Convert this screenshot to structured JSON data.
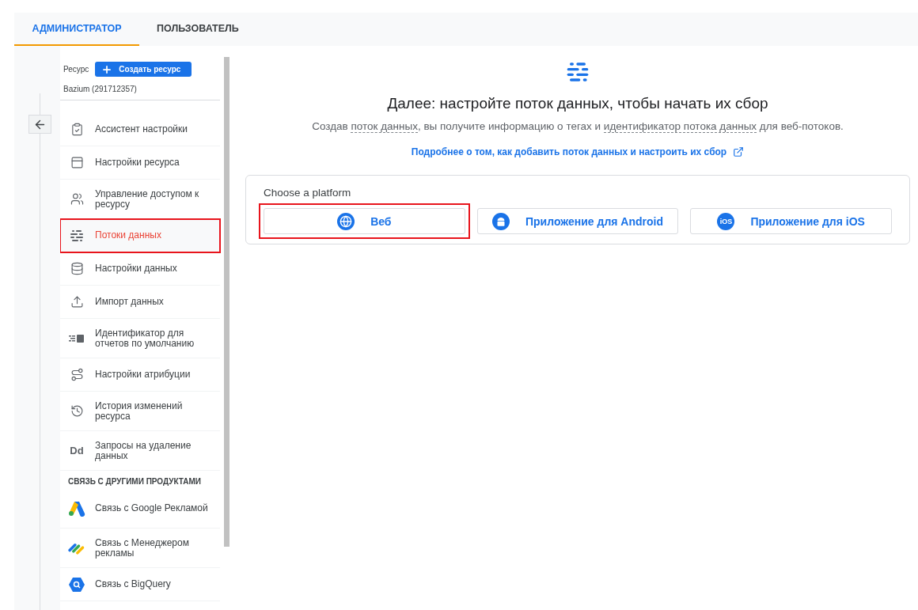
{
  "tabs": [
    {
      "label": "АДМИНИСТРАТОР",
      "selected": true
    },
    {
      "label": "ПОЛЬЗОВАТЕЛЬ",
      "selected": false
    }
  ],
  "resource": {
    "label": "Ресурс",
    "create_button": "Создать ресурс",
    "name": "Bazium (291712357)"
  },
  "sidebar": {
    "sections": [
      {
        "items": [
          {
            "label": "Ассистент настройки",
            "selected": false,
            "highlighted": false
          },
          {
            "label": "Настройки ресурса",
            "selected": false,
            "highlighted": false
          },
          {
            "label": "Управление доступом к ресурсу",
            "selected": false,
            "highlighted": false
          },
          {
            "label": "Потоки данных",
            "selected": true,
            "highlighted": true
          },
          {
            "label": "Настройки данных",
            "selected": false,
            "highlighted": false
          },
          {
            "label": "Импорт данных",
            "selected": false,
            "highlighted": false
          },
          {
            "label": "Идентификатор для отчетов по умолчанию",
            "selected": false,
            "highlighted": false
          },
          {
            "label": "Настройки атрибуции",
            "selected": false,
            "highlighted": false
          },
          {
            "label": "История изменений ресурса",
            "selected": false,
            "highlighted": false
          },
          {
            "label": "Запросы на удаление данных",
            "selected": false,
            "highlighted": false,
            "icon_text": "Dd"
          }
        ]
      },
      {
        "heading": "СВЯЗЬ С ДРУГИМИ ПРОДУКТАМИ",
        "items": [
          {
            "label": "Связь с Google Рекламой",
            "selected": false,
            "highlighted": false
          },
          {
            "label": "Связь с Менеджером рекламы",
            "selected": false,
            "highlighted": false
          },
          {
            "label": "Связь с BigQuery",
            "selected": false,
            "highlighted": false
          }
        ]
      }
    ]
  },
  "main": {
    "title": "Далее: настройте поток данных, чтобы начать их сбор",
    "description": [
      {
        "kind": "plain",
        "text": "Создав "
      },
      {
        "kind": "term",
        "text": "поток данных"
      },
      {
        "kind": "plain",
        "text": ", вы получите информацию о тегах и "
      },
      {
        "kind": "term",
        "text": "идентификатор потока данных"
      },
      {
        "kind": "plain",
        "text": " для веб-потоков."
      }
    ],
    "learn_more_link": "Подробнее о том, как добавить поток данных и настроить их сбор",
    "platform_card": {
      "title": "Choose a platform",
      "platforms": [
        {
          "label": "Веб",
          "highlighted": true
        },
        {
          "label": "Приложение для Android",
          "highlighted": false
        },
        {
          "label": "Приложение для iOS",
          "highlighted": false,
          "icon_text": "iOS"
        }
      ]
    }
  }
}
